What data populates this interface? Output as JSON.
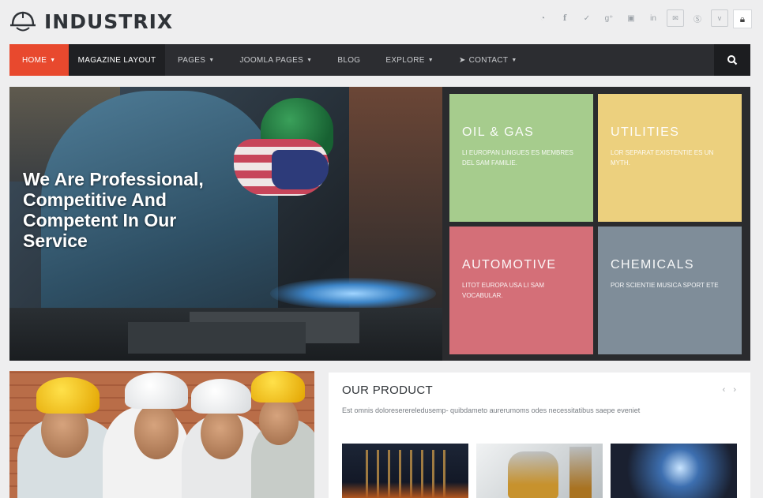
{
  "logo": {
    "text": "INDUSTRIX"
  },
  "social_icons": [
    "rss-icon",
    "facebook-icon",
    "twitter-icon",
    "google-plus-icon",
    "youtube-icon",
    "linkedin-icon",
    "email-icon",
    "skype-icon",
    "vimeo-icon",
    "lock-icon"
  ],
  "nav": {
    "home": "HOME",
    "magazine": "MAGAZINE LAYOUT",
    "pages": "PAGES",
    "joomla": "JOOMLA PAGES",
    "blog": "BLOG",
    "explore": "EXPLORE",
    "contact": "CONTACT"
  },
  "hero": {
    "title": "We Are Professional, Competitive And Competent In Our Service"
  },
  "tiles": [
    {
      "title": "OIL & GAS",
      "text": "LI EUROPAN LINGUES ES MEMBRES DEL SAM FAMILIE.",
      "color": "#a6cc8d"
    },
    {
      "title": "UTILITIES",
      "text": "LOR SEPARAT EXISTENTIE ES UN MYTH.",
      "color": "#ecd07e"
    },
    {
      "title": "AUTOMOTIVE",
      "text": "LITOT EUROPA USA LI SAM VOCABULAR.",
      "color": "#d46f78"
    },
    {
      "title": "CHEMICALS",
      "text": "POR SCIENTIE MUSICA SPORT ETE",
      "color": "#7f8d99"
    }
  ],
  "product": {
    "title": "OUR PRODUCT",
    "description": "Est omnis doloreserereledusemp- quibdameto aurerumoms odes necessitatibus saepe eveniet",
    "prev": "‹",
    "next": "›"
  },
  "colors": {
    "accent": "#e8492e",
    "nav_bg": "#2c2d31"
  }
}
